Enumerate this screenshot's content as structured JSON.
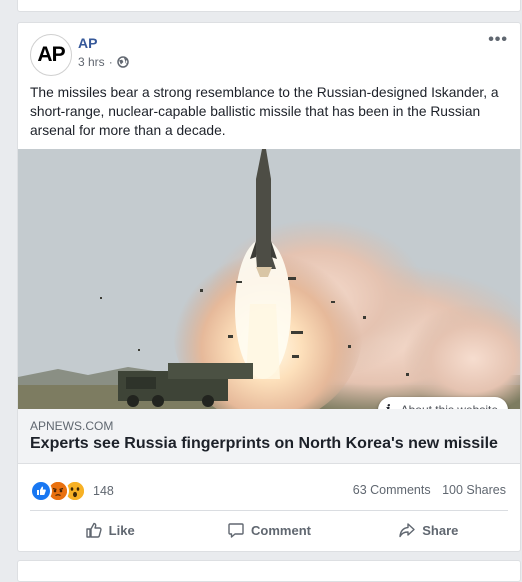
{
  "post": {
    "page_name": "AP",
    "avatar_text": "AP",
    "timestamp": "3 hrs",
    "dot": "·",
    "more_label": "•••",
    "text": "The missiles bear a strong resemblance to the Russian-designed Iskander, a short-range, nuclear-capable ballistic missile that has been in the Russian arsenal for more than a decade."
  },
  "link": {
    "about_icon": "i",
    "about_label": "About this website",
    "domain": "APNEWS.COM",
    "title": "Experts see Russia fingerprints on North Korea's new missile"
  },
  "engagement": {
    "reaction_count": "148",
    "reactions": [
      "like",
      "angry",
      "wow"
    ],
    "comments": "63 Comments",
    "shares": "100 Shares"
  },
  "actions": {
    "like": "Like",
    "comment": "Comment",
    "share": "Share"
  },
  "colors": {
    "link_blue": "#365899",
    "like_blue": "#1877f2",
    "angry_orange": "#e9710f",
    "wow_yellow": "#f7b125"
  }
}
